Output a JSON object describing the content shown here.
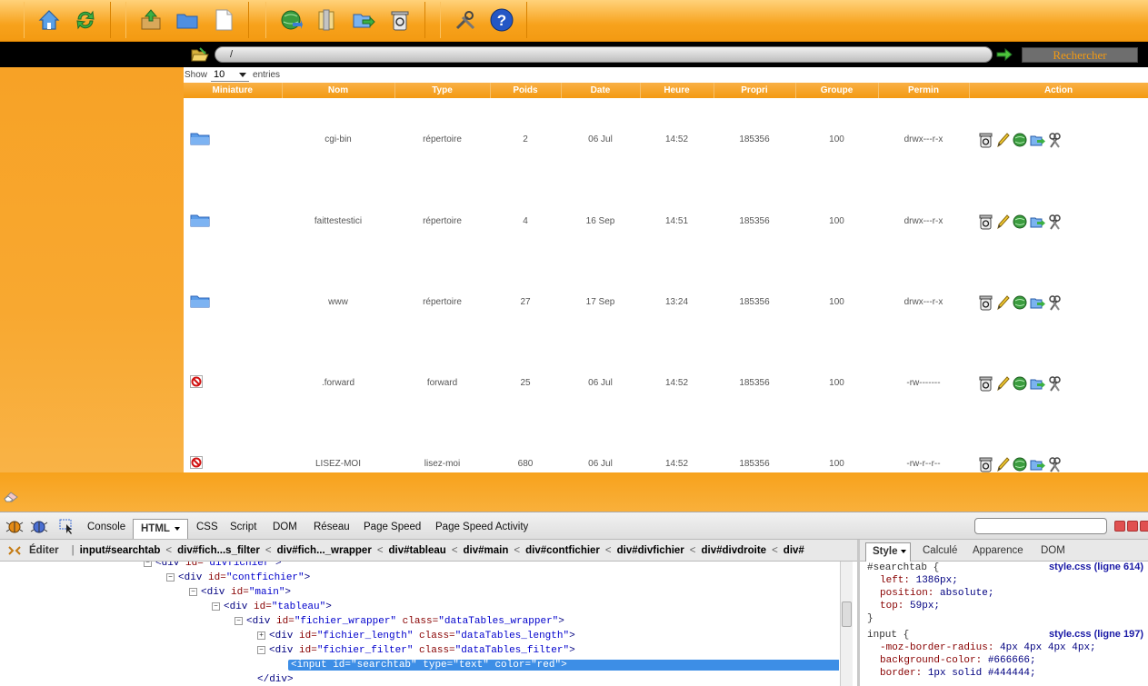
{
  "toolbar": {
    "groups": [
      [
        "home-icon",
        "refresh-icon"
      ],
      [
        "upload-icon",
        "new-folder-icon",
        "new-file-icon"
      ],
      [
        "network-icon",
        "archive-icon",
        "move-icon",
        "trash-icon"
      ],
      [
        "settings-icon",
        "help-icon"
      ]
    ],
    "help_glyph": "?"
  },
  "pathbar": {
    "path": "/",
    "search_label": "Rechercher"
  },
  "table": {
    "show_label": "Show",
    "page_length": "10",
    "entries_label": "entries",
    "columns": [
      "Miniature",
      "Nom",
      "Type",
      "Poids",
      "Date",
      "Heure",
      "Propri",
      "Groupe",
      "Permin",
      "Action"
    ],
    "rows": [
      {
        "icon": "folder-icon",
        "name": "cgi-bin",
        "type": "répertoire",
        "size": "2",
        "date": "06 Jul",
        "time": "14:52",
        "owner": "185356",
        "group": "100",
        "perms": "drwx---r-x"
      },
      {
        "icon": "folder-icon",
        "name": "faittestestici",
        "type": "répertoire",
        "size": "4",
        "date": "16 Sep",
        "time": "14:51",
        "owner": "185356",
        "group": "100",
        "perms": "drwx---r-x"
      },
      {
        "icon": "folder-icon",
        "name": "www",
        "type": "répertoire",
        "size": "27",
        "date": "17 Sep",
        "time": "13:24",
        "owner": "185356",
        "group": "100",
        "perms": "drwx---r-x"
      },
      {
        "icon": "forbidden-icon",
        "name": ".forward",
        "type": "forward",
        "size": "25",
        "date": "06 Jul",
        "time": "14:52",
        "owner": "185356",
        "group": "100",
        "perms": "-rw-------"
      },
      {
        "icon": "forbidden-icon",
        "name": "LISEZ-MOI",
        "type": "lisez-moi",
        "size": "680",
        "date": "06 Jul",
        "time": "14:52",
        "owner": "185356",
        "group": "100",
        "perms": "-rw-r--r--"
      }
    ]
  },
  "firebug": {
    "tabs": [
      "Console",
      "HTML",
      "CSS",
      "Script",
      "DOM",
      "Réseau",
      "Page Speed",
      "Page Speed Activity"
    ],
    "edit_label": "Éditer",
    "breadcrumb": [
      "input#searchtab",
      "div#fich...s_filter",
      "div#fich..._wrapper",
      "div#tableau",
      "div#main",
      "div#contfichier",
      "div#divfichier",
      "div#divdroite",
      "div#"
    ],
    "side_tabs": [
      "Style",
      "Calculé",
      "Apparence",
      "DOM"
    ],
    "html_lines": [
      {
        "indent": 0,
        "toggle": "−",
        "tag": "div",
        "attrs": [
          [
            "id",
            "divfichier"
          ]
        ]
      },
      {
        "indent": 1,
        "toggle": "−",
        "tag": "div",
        "attrs": [
          [
            "id",
            "contfichier"
          ]
        ]
      },
      {
        "indent": 2,
        "toggle": "−",
        "tag": "div",
        "attrs": [
          [
            "id",
            "main"
          ]
        ]
      },
      {
        "indent": 3,
        "toggle": "−",
        "tag": "div",
        "attrs": [
          [
            "id",
            "tableau"
          ]
        ]
      },
      {
        "indent": 4,
        "toggle": "−",
        "tag": "div",
        "attrs": [
          [
            "id",
            "fichier_wrapper"
          ],
          [
            "class",
            "dataTables_wrapper"
          ]
        ]
      },
      {
        "indent": 5,
        "toggle": "+",
        "tag": "div",
        "attrs": [
          [
            "id",
            "fichier_length"
          ],
          [
            "class",
            "dataTables_length"
          ]
        ]
      },
      {
        "indent": 5,
        "toggle": "−",
        "tag": "div",
        "attrs": [
          [
            "id",
            "fichier_filter"
          ],
          [
            "class",
            "dataTables_filter"
          ]
        ]
      },
      {
        "indent": 6,
        "toggle": "",
        "tag": "input",
        "attrs": [
          [
            "id",
            "searchtab"
          ],
          [
            "type",
            "text"
          ],
          [
            "color",
            "red"
          ]
        ],
        "selected": true
      },
      {
        "indent": 5,
        "toggle": "",
        "tag": "/div",
        "attrs": []
      }
    ],
    "css_rules": [
      {
        "selector": "#searchtab {",
        "source": "style.css (ligne 614)",
        "props": [
          [
            "left",
            "1386px;"
          ],
          [
            "position",
            "absolute;"
          ],
          [
            "top",
            "59px;"
          ]
        ],
        "close": "}"
      },
      {
        "selector": "input {",
        "source": "style.css (ligne 197)",
        "props": [
          [
            "-moz-border-radius",
            "4px 4px 4px 4px;"
          ],
          [
            "background-color",
            "#666666;"
          ],
          [
            "border",
            "1px solid #444444;"
          ]
        ],
        "close": ""
      }
    ]
  }
}
